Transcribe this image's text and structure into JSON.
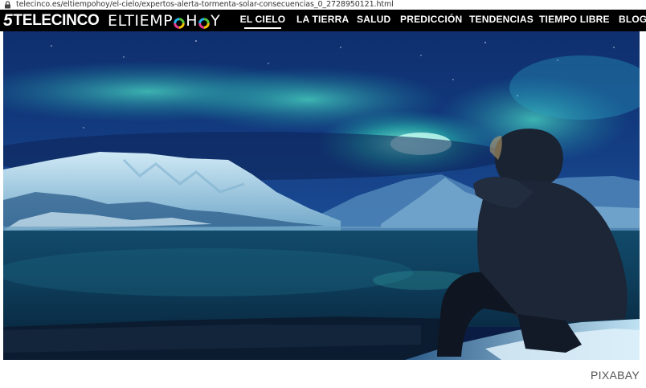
{
  "browser": {
    "url": "telecinco.es/eltiempohoy/el-cielo/expertos-alerta-tormenta-solar-consecuencias_0_2728950121.html",
    "lock_icon": "lock-icon"
  },
  "header": {
    "logo_telecinco": {
      "number": "5",
      "text": "TELECINCO"
    },
    "logo_eltiempohoy": {
      "prefix": "ELTIEMP",
      "suffix": "H",
      "last": "Y"
    },
    "nav": [
      {
        "label": "EL CIELO",
        "active": true
      },
      {
        "label": "LA TIERRA",
        "active": false
      },
      {
        "label": "SALUD",
        "active": false
      },
      {
        "label": "PREDICCIÓN",
        "active": false
      },
      {
        "label": "TENDENCIAS",
        "active": false
      },
      {
        "label": "TIEMPO LIBRE",
        "active": false
      },
      {
        "label": "BLOG",
        "active": false
      }
    ]
  },
  "image": {
    "credit": "PIXABAY"
  },
  "colors": {
    "navbar_bg": "#000000",
    "aurora": "#3de0c0",
    "sky": "#0d2a66",
    "water": "#0c3a5c"
  }
}
